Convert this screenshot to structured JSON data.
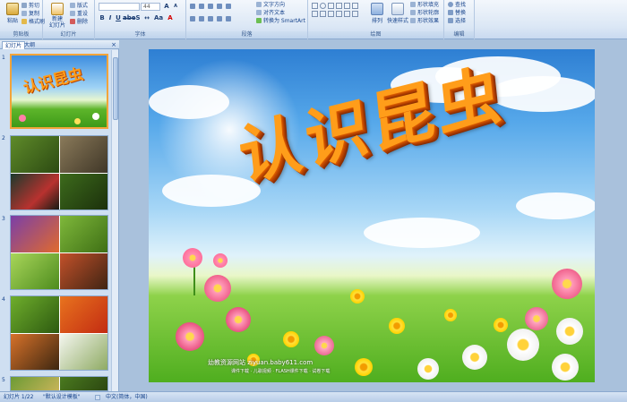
{
  "ribbon": {
    "clipboard": {
      "paste": "粘贴",
      "cut": "剪切",
      "copy": "复制",
      "format_painter": "格式刷",
      "group": "剪贴板"
    },
    "slides": {
      "new_slide": "新建\n幻灯片",
      "layout": "版式",
      "reset": "重设",
      "delete": "删除",
      "group": "幻灯片"
    },
    "font": {
      "font_size": "44",
      "group": "字体"
    },
    "paragraph": {
      "text_direction": "文字方向",
      "align_text": "对齐文本",
      "smartart": "转换为 SmartArt",
      "group": "段落"
    },
    "drawing": {
      "arrange": "排列",
      "quick_styles": "快速样式",
      "shape_fill": "形状填充",
      "shape_outline": "形状轮廓",
      "shape_effects": "形状效果",
      "group": "绘图"
    },
    "editing": {
      "find": "查找",
      "replace": "替换",
      "select": "选择",
      "group": "编辑"
    }
  },
  "pane": {
    "tabs": [
      "幻灯片",
      "大纲"
    ],
    "close": "×",
    "slide_numbers": [
      "1",
      "2",
      "3",
      "4",
      "5"
    ],
    "thumb1_title": "认识昆虫"
  },
  "slide": {
    "title": "认识昆虫",
    "watermark": "幼教资源网站 ziyuan.baby611.com",
    "watermark_sub": "课件下载 · 儿歌视频 · FLASH课件下载 · 试卷下载"
  },
  "status": {
    "slide_info": "幻灯片 1/22",
    "theme": "\"默认设计模板\"",
    "language": "中文(简体，中国)"
  },
  "colors": {
    "ribbon_bg": "#dbe7f5",
    "title_orange": "#ff9d1a",
    "selected_thumb_border": "#f2a43a",
    "workspace_bg": "#a9c1dc"
  }
}
